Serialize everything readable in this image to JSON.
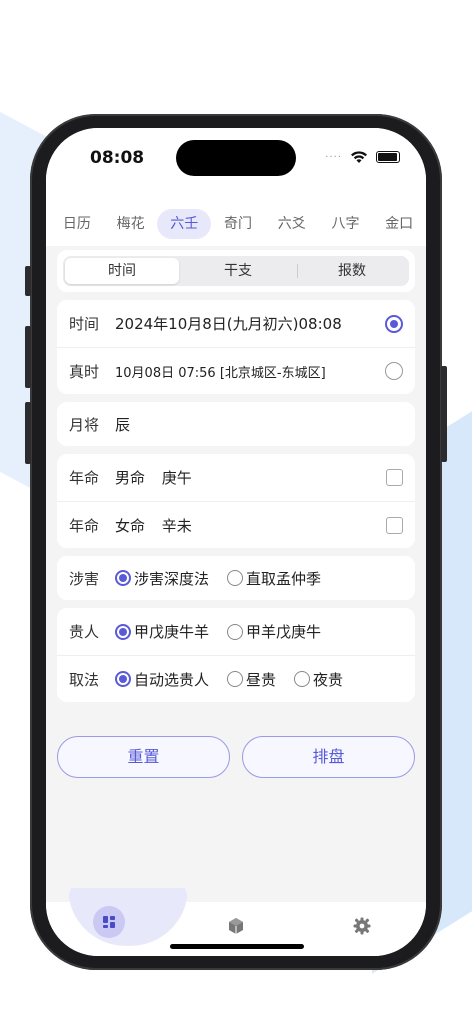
{
  "status": {
    "time": "08:08",
    "signal_dots": "····"
  },
  "tabs": [
    {
      "label": "日历"
    },
    {
      "label": "梅花"
    },
    {
      "label": "六壬",
      "active": true
    },
    {
      "label": "奇门"
    },
    {
      "label": "六爻"
    },
    {
      "label": "八字"
    },
    {
      "label": "金口"
    }
  ],
  "segment": {
    "items": [
      "时间",
      "干支",
      "报数"
    ],
    "selected": "时间"
  },
  "time_card": {
    "time_label": "时间",
    "time_value": "2024年10月8日(九月初六)08:08",
    "time_selected": true,
    "true_label": "真时",
    "true_value": "10月08日 07:56 [北京城区-东城区]",
    "true_selected": false
  },
  "month_general": {
    "label": "月将",
    "value": "辰"
  },
  "birth_years": [
    {
      "label": "年命",
      "gender": "男命",
      "ganzhi": "庚午",
      "checked": false
    },
    {
      "label": "年命",
      "gender": "女命",
      "ganzhi": "辛未",
      "checked": false
    }
  ],
  "shehai": {
    "label": "涉害",
    "options": [
      "涉害深度法",
      "直取孟仲季"
    ],
    "selected": "涉害深度法"
  },
  "guiren": {
    "label": "贵人",
    "options": [
      "甲戊庚牛羊",
      "甲羊戊庚牛"
    ],
    "selected": "甲戊庚牛羊"
  },
  "qufa": {
    "label": "取法",
    "options": [
      "自动选贵人",
      "昼贵",
      "夜贵"
    ],
    "selected": "自动选贵人"
  },
  "buttons": {
    "reset": "重置",
    "chart": "排盘"
  },
  "colors": {
    "accent": "#5a5ad8",
    "accent_light": "#e8e8fb",
    "background": "#f4f4f5"
  },
  "nav": {
    "icons": [
      "grid-icon",
      "cube-icon",
      "gear-icon"
    ],
    "active": "grid-icon"
  }
}
